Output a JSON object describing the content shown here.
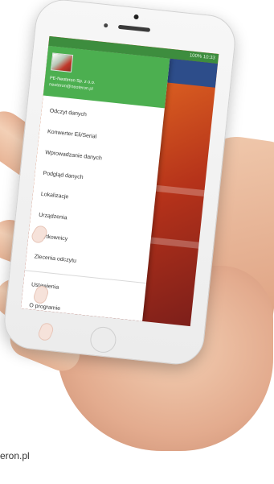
{
  "status_bar": {
    "time_text": "100% 10:33"
  },
  "drawer": {
    "company": "PE-Neoteron Sp. z o.o.",
    "email": "neoteron@neoteron.pl",
    "menu_items": [
      {
        "label": "Odczyt danych"
      },
      {
        "label": "Konwerter Eli/Serial"
      },
      {
        "label": "Wprowadzanie danych"
      },
      {
        "label": "Podgląd danych"
      },
      {
        "label": "Lokalizacje"
      },
      {
        "label": "Urządzenia"
      },
      {
        "label": "Użytkownicy"
      },
      {
        "label": "Zlecenia odczytu"
      }
    ],
    "secondary_items": [
      {
        "label": "Ustawienia"
      },
      {
        "label": "O programie"
      }
    ]
  },
  "caption": {
    "text": "eron.pl"
  }
}
